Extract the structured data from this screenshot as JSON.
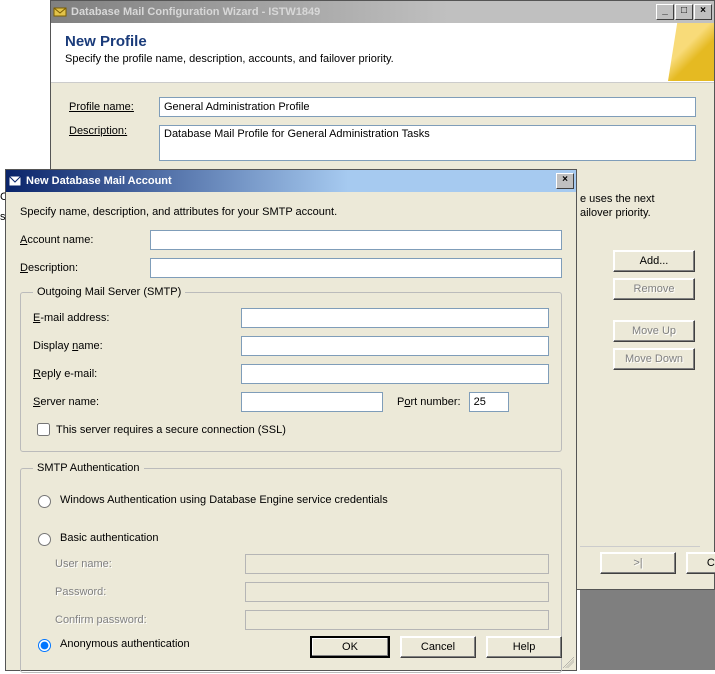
{
  "parent_window": {
    "title": "Database Mail Configuration Wizard - ISTW1849",
    "header_title": "New Profile",
    "header_sub": "Specify the profile name, description, accounts, and failover priority.",
    "profile_name_label": "Profile name:",
    "profile_name_value": "General Administration Profile",
    "description_label": "Description:",
    "description_value": "Database Mail Profile for General Administration Tasks",
    "hint_right": "e uses the next ailover priority.",
    "side_text_top": "Coordinator",
    "side_text_bottom": "s disabled)",
    "buttons": {
      "add": "Add...",
      "remove": "Remove",
      "move_up": "Move Up",
      "move_down": "Move Down",
      "next": ">|",
      "cancel": "Cancel"
    }
  },
  "dialog": {
    "title": "New Database Mail Account",
    "instruction": "Specify name, description, and attributes for your SMTP account.",
    "account_name_label": "Account name:",
    "account_name_value": "",
    "description_label": "Description:",
    "description_value": "",
    "smtp": {
      "legend": "Outgoing Mail Server (SMTP)",
      "email_label": "E-mail address:",
      "email_value": "",
      "display_name_label": "Display name:",
      "display_name_value": "",
      "reply_label": "Reply e-mail:",
      "reply_value": "",
      "server_name_label": "Server name:",
      "server_name_value": "",
      "port_label": "Port number:",
      "port_value": "25",
      "ssl_label": "This server requires a secure connection (SSL)"
    },
    "auth": {
      "legend": "SMTP Authentication",
      "windows_label": "Windows Authentication using Database Engine service credentials",
      "basic_label": "Basic authentication",
      "basic_user_label": "User name:",
      "basic_pass_label": "Password:",
      "basic_confirm_label": "Confirm password:",
      "anon_label": "Anonymous authentication"
    },
    "buttons": {
      "ok": "OK",
      "cancel": "Cancel",
      "help": "Help"
    }
  }
}
